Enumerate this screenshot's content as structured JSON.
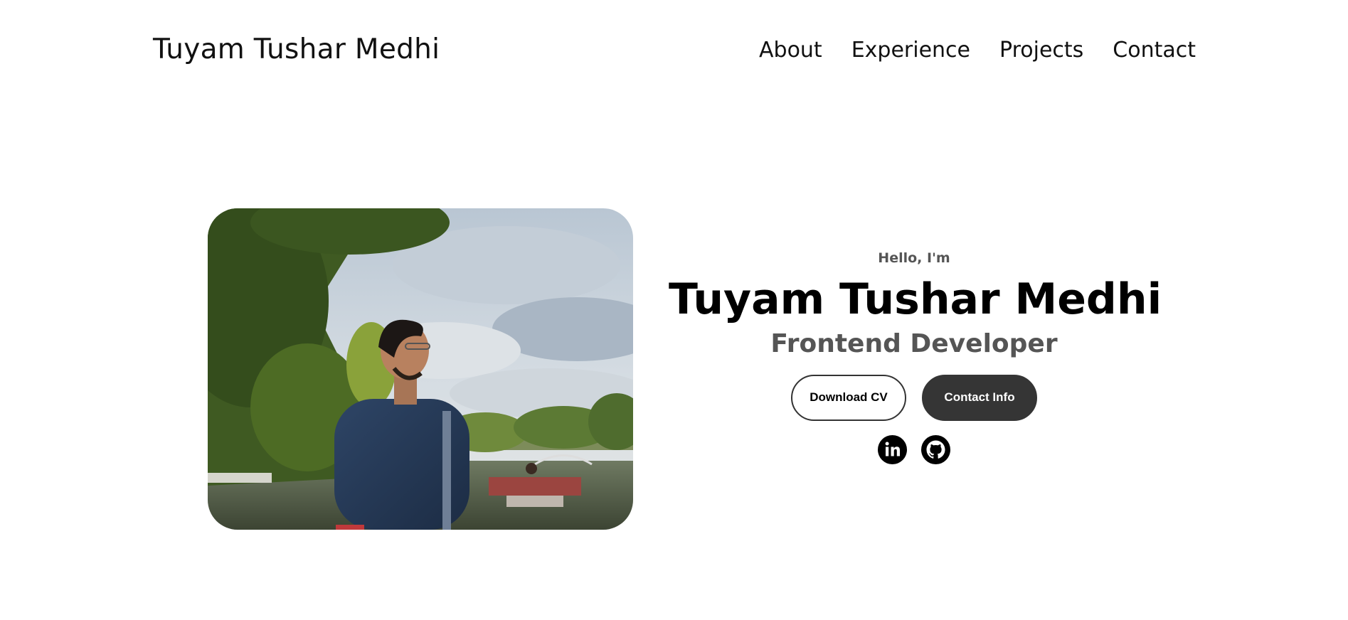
{
  "nav": {
    "logo": "Tuyam Tushar Medhi",
    "links": [
      {
        "label": "About"
      },
      {
        "label": "Experience"
      },
      {
        "label": "Projects"
      },
      {
        "label": "Contact"
      }
    ]
  },
  "hero": {
    "greeting": "Hello, I'm",
    "name": "Tuyam Tushar Medhi",
    "title": "Frontend Developer",
    "buttons": {
      "download_cv": "Download CV",
      "contact_info": "Contact Info"
    },
    "socials": [
      {
        "icon": "linkedin-icon"
      },
      {
        "icon": "github-icon"
      }
    ]
  },
  "colors": {
    "text_primary": "#000000",
    "text_secondary": "#555555",
    "button_dark": "#353535",
    "background": "#ffffff"
  }
}
